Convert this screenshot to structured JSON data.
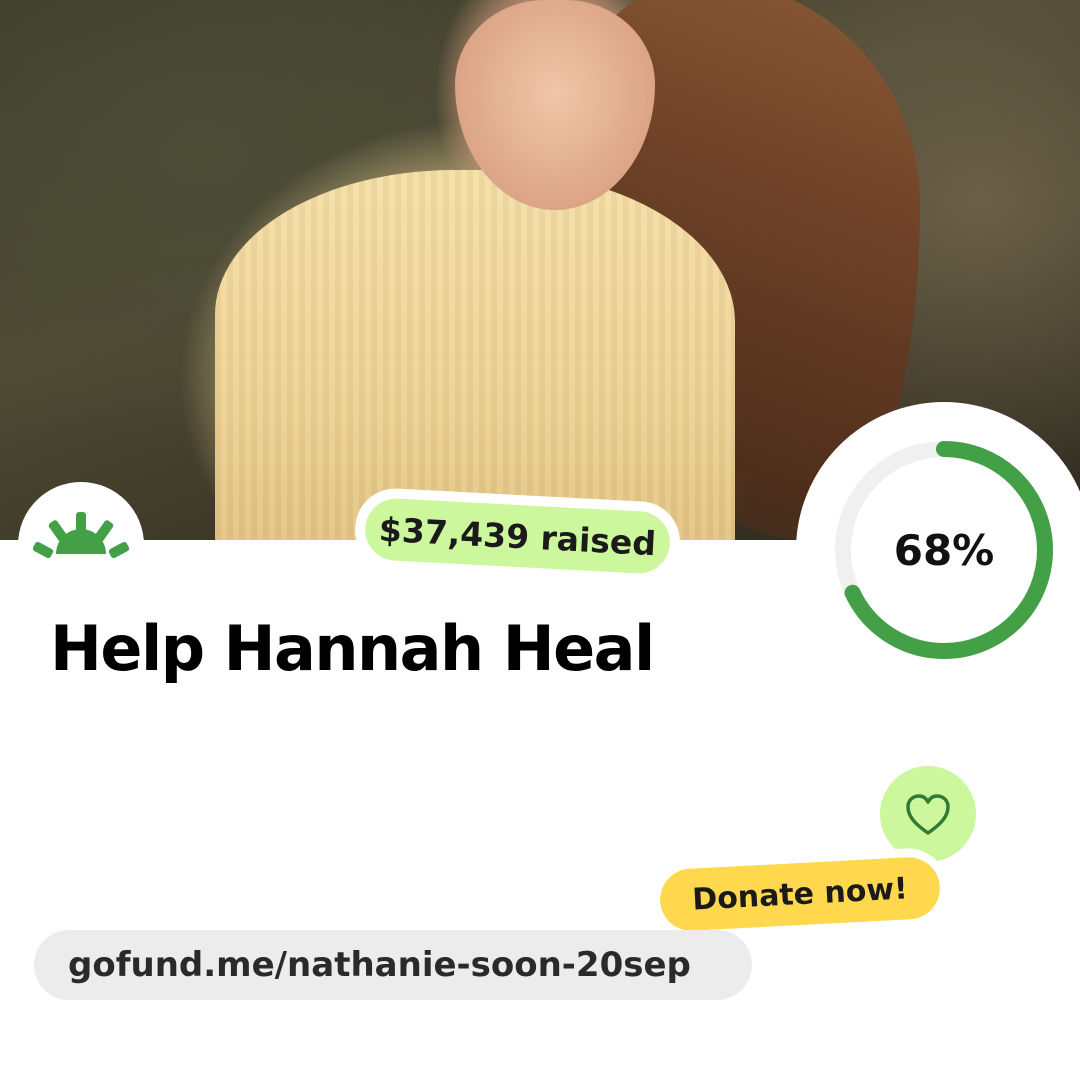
{
  "campaign": {
    "title": "Help Hannah Heal",
    "raised_label": "$37,439 raised",
    "progress_label": "68%",
    "progress_fraction": 0.68,
    "url": "gofund.me/nathanie-soon-20sep"
  },
  "actions": {
    "donate_label": "Donate now!"
  },
  "icons": {
    "logo": "gofundme-sunrise-icon",
    "favorite": "heart-icon"
  },
  "colors": {
    "brand_green": "#43a047",
    "light_green": "#cdf79d",
    "donate_yellow": "#ffd84d",
    "track_gray": "#f0f0f0",
    "url_pill": "#ececec"
  }
}
